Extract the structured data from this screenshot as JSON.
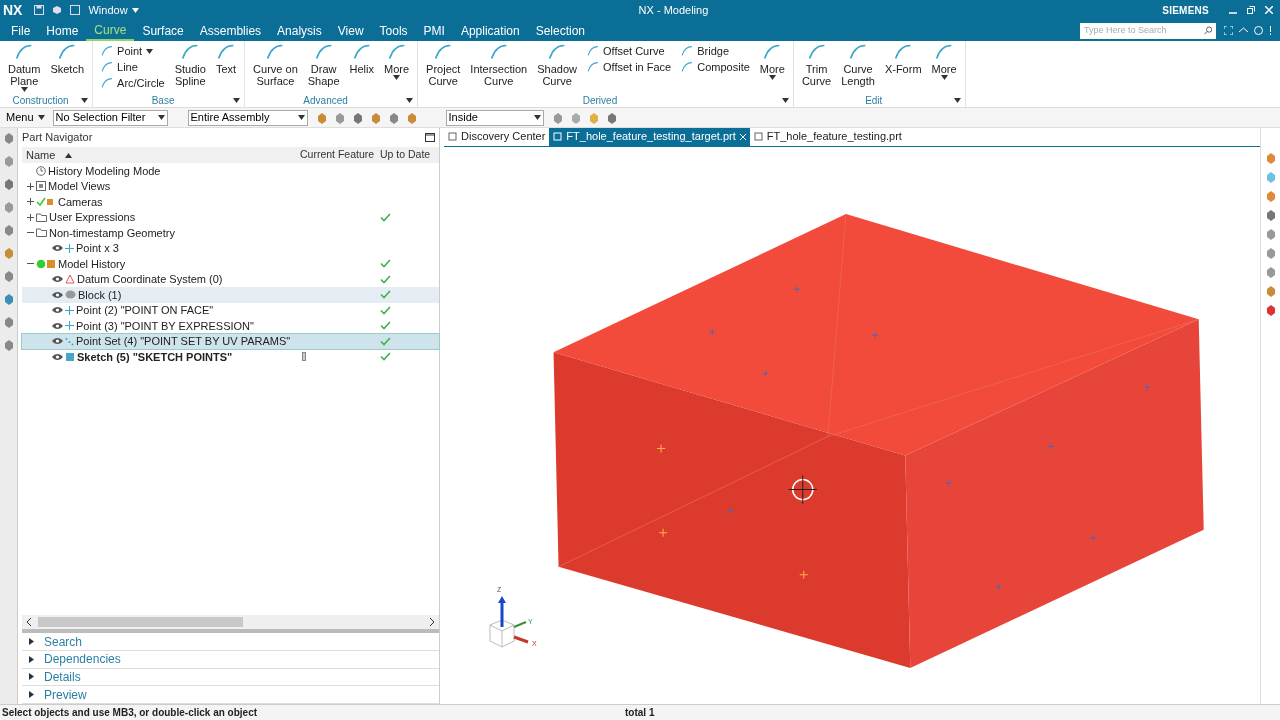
{
  "title_bar": {
    "logo": "NX",
    "quick_access": "Window",
    "title": "NX - Modeling",
    "brand": "SIEMENS",
    "search": {
      "placeholder": "Type Here to Search"
    }
  },
  "menu_tabs": [
    {
      "label": "File",
      "selected": false
    },
    {
      "label": "Home",
      "selected": false
    },
    {
      "label": "Curve",
      "selected": true
    },
    {
      "label": "Surface",
      "selected": false
    },
    {
      "label": "Assemblies",
      "selected": false
    },
    {
      "label": "Analysis",
      "selected": false
    },
    {
      "label": "View",
      "selected": false
    },
    {
      "label": "Tools",
      "selected": false
    },
    {
      "label": "PMI",
      "selected": false
    },
    {
      "label": "Application",
      "selected": false
    },
    {
      "label": "Selection",
      "selected": false
    }
  ],
  "ribbon": [
    {
      "label": "Construction",
      "items": [
        {
          "kind": "large",
          "lines": [
            "Datum",
            "Plane"
          ],
          "menu": true
        },
        {
          "kind": "large",
          "lines": [
            "Sketch"
          ],
          "menu": false
        }
      ]
    },
    {
      "label": "Base",
      "items": [
        {
          "kind": "stack",
          "items": [
            {
              "label": "Point",
              "menu": true
            },
            {
              "label": "Line",
              "menu": false
            },
            {
              "label": "Arc/Circle",
              "menu": false
            }
          ]
        },
        {
          "kind": "large",
          "lines": [
            "Studio",
            "Spline"
          ],
          "menu": false
        },
        {
          "kind": "large",
          "lines": [
            "Text"
          ],
          "menu": false
        }
      ]
    },
    {
      "label": "Advanced",
      "items": [
        {
          "kind": "large",
          "lines": [
            "Curve on",
            "Surface"
          ],
          "menu": false
        },
        {
          "kind": "large",
          "lines": [
            "Draw",
            "Shape"
          ],
          "menu": false
        },
        {
          "kind": "large",
          "lines": [
            "Helix"
          ],
          "menu": false
        },
        {
          "kind": "large",
          "lines": [
            "More"
          ],
          "menu": true
        }
      ]
    },
    {
      "label": "Derived",
      "items": [
        {
          "kind": "large",
          "lines": [
            "Project",
            "Curve"
          ],
          "menu": false
        },
        {
          "kind": "large",
          "lines": [
            "Intersection",
            "Curve"
          ],
          "menu": false
        },
        {
          "kind": "large",
          "lines": [
            "Shadow",
            "Curve"
          ],
          "menu": false
        },
        {
          "kind": "stack",
          "items": [
            {
              "label": "Offset Curve",
              "menu": false
            },
            {
              "label": "Offset in Face",
              "menu": false
            }
          ]
        },
        {
          "kind": "stack",
          "items": [
            {
              "label": "Bridge",
              "menu": false
            },
            {
              "label": "Composite",
              "menu": false
            }
          ]
        },
        {
          "kind": "large",
          "lines": [
            "More"
          ],
          "menu": true
        }
      ]
    },
    {
      "label": "Edit",
      "items": [
        {
          "kind": "large",
          "lines": [
            "Trim",
            "Curve"
          ],
          "menu": false
        },
        {
          "kind": "large",
          "lines": [
            "Curve",
            "Length"
          ],
          "menu": false
        },
        {
          "kind": "large",
          "lines": [
            "X-Form"
          ],
          "menu": false
        },
        {
          "kind": "large",
          "lines": [
            "More"
          ],
          "menu": true
        }
      ]
    }
  ],
  "toolbar": {
    "menu": "Menu",
    "selection_filter": "No Selection Filter",
    "scope": "Entire Assembly",
    "selection_mode": "Inside"
  },
  "part_navigator": {
    "title": "Part Navigator",
    "columns": [
      "Name",
      "Current Feature",
      "Up to Date"
    ],
    "rows": [
      {
        "kind": "mode",
        "label": "History Modeling Mode",
        "visible": false,
        "up_to_date": false,
        "selected": false,
        "hovered": false,
        "current": false
      },
      {
        "kind": "views",
        "label": "Model Views",
        "expanded": false,
        "visible": false,
        "up_to_date": false,
        "selected": false,
        "hovered": false,
        "current": false
      },
      {
        "kind": "cameras",
        "label": "Cameras",
        "expanded": false,
        "visible": false,
        "up_to_date": false,
        "selected": false,
        "hovered": false,
        "current": false
      },
      {
        "kind": "folder",
        "label": "User Expressions",
        "expanded": false,
        "visible": false,
        "up_to_date": true,
        "selected": false,
        "hovered": false,
        "current": false
      },
      {
        "kind": "folder",
        "label": "Non-timestamp Geometry",
        "expanded": true,
        "visible": false,
        "up_to_date": false,
        "selected": false,
        "hovered": false,
        "current": false,
        "children": [
          {
            "kind": "point",
            "label": "Point x 3",
            "visible": true,
            "up_to_date": false,
            "selected": false,
            "hovered": false,
            "current": false
          }
        ]
      },
      {
        "kind": "history",
        "label": "Model History",
        "expanded": true,
        "visible": false,
        "up_to_date": true,
        "selected": false,
        "hovered": false,
        "current": false,
        "children": [
          {
            "kind": "datum",
            "label": "Datum Coordinate System (0)",
            "visible": true,
            "up_to_date": true,
            "selected": false,
            "hovered": false,
            "current": false
          },
          {
            "kind": "block",
            "label": "Block (1)",
            "visible": true,
            "up_to_date": true,
            "selected": false,
            "hovered": true,
            "current": false
          },
          {
            "kind": "point",
            "label": "Point (2) \"POINT ON FACE\"",
            "visible": true,
            "up_to_date": true,
            "selected": false,
            "hovered": false,
            "current": false
          },
          {
            "kind": "point",
            "label": "Point (3) \"POINT BY EXPRESSION\"",
            "visible": true,
            "up_to_date": true,
            "selected": false,
            "hovered": false,
            "current": false
          },
          {
            "kind": "pointset",
            "label": "Point Set (4) \"POINT SET BY UV PARAMS\"",
            "visible": true,
            "up_to_date": true,
            "selected": true,
            "hovered": false,
            "current": false
          },
          {
            "kind": "sketch",
            "label": "Sketch (5) \"SKETCH POINTS\"",
            "visible": true,
            "up_to_date": true,
            "selected": false,
            "hovered": false,
            "current": true
          }
        ]
      }
    ],
    "panels": [
      {
        "label": "Search",
        "expanded": false
      },
      {
        "label": "Dependencies",
        "expanded": false
      },
      {
        "label": "Details",
        "expanded": false
      },
      {
        "label": "Preview",
        "expanded": false
      }
    ]
  },
  "doc_tabs": [
    {
      "label": "Discovery Center",
      "selected": false,
      "closable": false
    },
    {
      "label": "FT_hole_feature_testing_target.prt",
      "selected": true,
      "closable": true
    },
    {
      "label": "FT_hole_feature_testing.prt",
      "selected": false,
      "closable": false
    }
  ],
  "triad": {
    "z": "Z",
    "y": "Y",
    "x": "X"
  },
  "status_bar": {
    "prompt": "Select objects and use MB3, or double-click an object",
    "count": "total 1"
  }
}
